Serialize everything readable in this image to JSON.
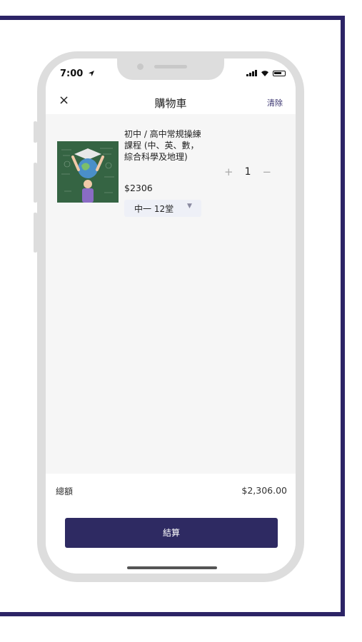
{
  "status_bar": {
    "time": "7:00",
    "location_icon": "location-arrow-icon",
    "signal_icon": "signal-icon",
    "wifi_icon": "wifi-icon",
    "battery_icon": "battery-icon"
  },
  "header": {
    "close_label": "×",
    "title": "購物車",
    "clear_label": "清除"
  },
  "cart": {
    "items": [
      {
        "name": "初中 / 高中常規操練課程 (中、英、數，綜合科學及地理)",
        "price": "$2306",
        "variant": "中一 12堂",
        "quantity": "1",
        "plus_label": "+",
        "minus_label": "−",
        "image_icon": "course-thumbnail-image"
      }
    ]
  },
  "summary": {
    "total_label": "總額",
    "total_value": "$2,306.00"
  },
  "checkout": {
    "label": "結算"
  },
  "colors": {
    "frame": "#2c2466",
    "primary_button": "#2e2a62",
    "clear_link": "#3a3470"
  }
}
